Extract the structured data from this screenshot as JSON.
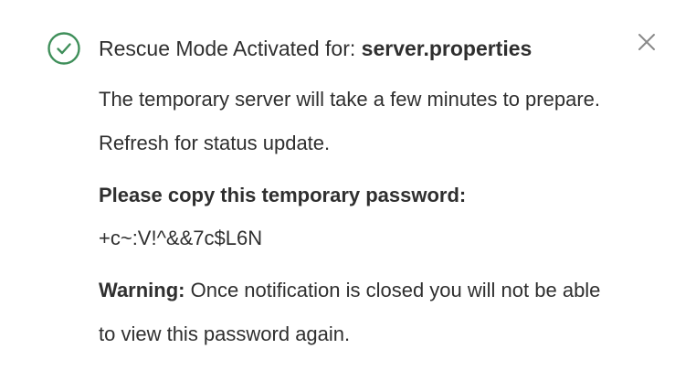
{
  "notification": {
    "title_prefix": "Rescue Mode Activated for: ",
    "title_filename": "server.properties",
    "message": "The temporary server will take a few minutes to prepare. Refresh for status update.",
    "password_label": "Please copy this temporary password:",
    "password_value": "+c~:V!^&&7c$L6N",
    "warning_label": "Warning:",
    "warning_text": " Once notification is closed you will not be able to view this password again.",
    "status_icon": "check-circle-icon",
    "close_icon": "close-icon"
  },
  "colors": {
    "success": "#3f8f5a",
    "text": "#2f2f2f",
    "close": "#8a8a8a"
  }
}
